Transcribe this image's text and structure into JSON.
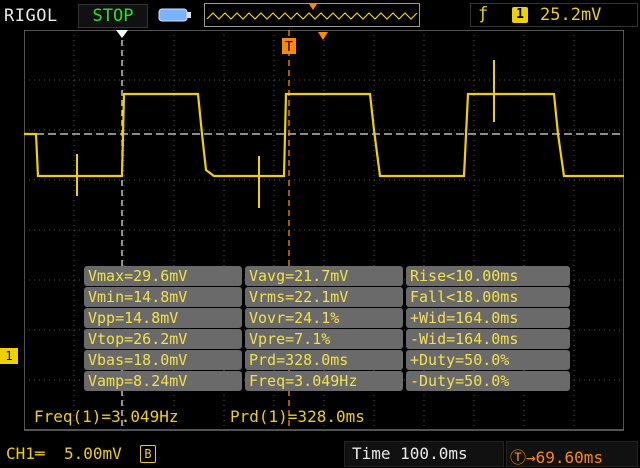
{
  "status": {
    "brand": "RIGOL",
    "run_state": "STOP",
    "trigger_edge_icon": "rising-edge-icon",
    "trigger_channel": "1",
    "trigger_level": "25.2mV"
  },
  "screen": {
    "channel_marker": "1",
    "trigger_marker": "T"
  },
  "measurements": {
    "rows": [
      [
        "Vmax=29.6mV",
        "Vavg=21.7mV",
        "Rise<10.00ms"
      ],
      [
        "Vmin=14.8mV",
        "Vrms=22.1mV",
        "Fall<18.00ms"
      ],
      [
        "Vpp=14.8mV",
        "Vovr=24.1%",
        "+Wid=164.0ms"
      ],
      [
        "Vtop=26.2mV",
        "Vpre=7.1%",
        "-Wid=164.0ms"
      ],
      [
        "Vbas=18.0mV",
        "Prd=328.0ms",
        "+Duty=50.0%"
      ],
      [
        "Vamp=8.24mV",
        "Freq=3.049Hz",
        "-Duty=50.0%"
      ]
    ],
    "freq_line": "Freq(1)=3.049Hz",
    "prd_line": "Prd(1)=328.0ms"
  },
  "bottom": {
    "channel_label": "CH1",
    "volts_per_div": "5.00mV",
    "bw_badge": "B",
    "timebase": "Time  100.0ms",
    "trigger_offset": "69.60ms"
  },
  "colors": {
    "trace": "#f0d000",
    "trigger": "#ff8a00",
    "grid": "#6e6e6e"
  }
}
